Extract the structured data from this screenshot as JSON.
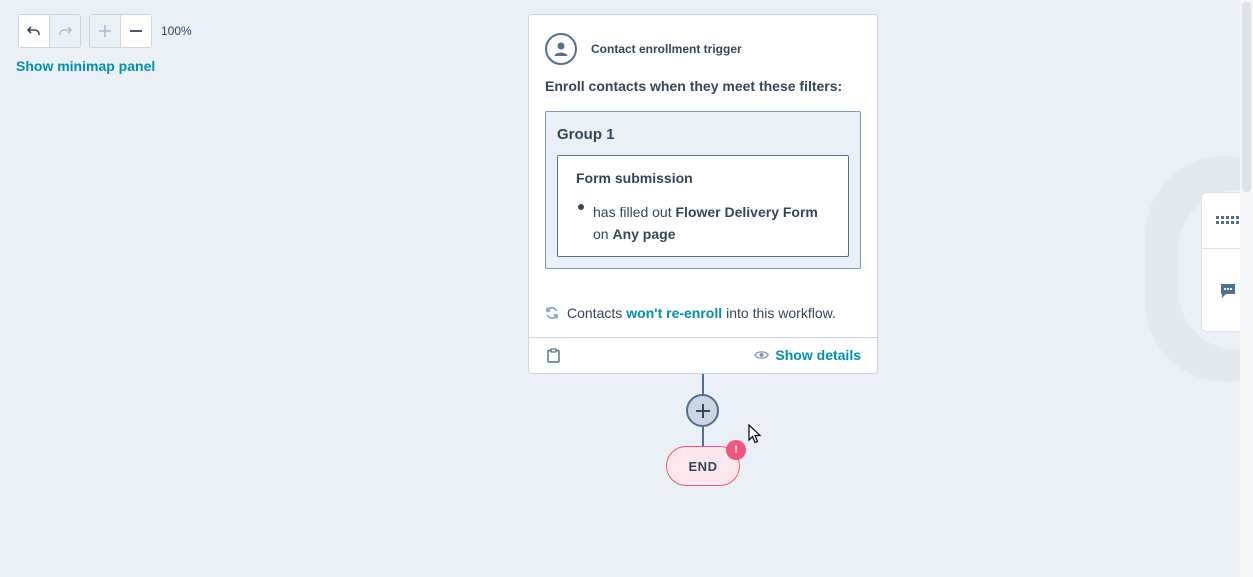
{
  "toolbar": {
    "zoom_level": "100%",
    "minimap_link": "Show minimap panel",
    "icons": [
      "undo-icon",
      "redo-icon",
      "zoom-in-icon",
      "zoom-out-icon"
    ]
  },
  "trigger_card": {
    "title": "Contact enrollment trigger",
    "enroll_text": "Enroll contacts when they meet these filters:",
    "group": {
      "title": "Group 1",
      "filter": {
        "title": "Form submission",
        "line1_prefix": "has filled out",
        "form_name": "Flower Delivery Form",
        "line2_prefix": "on",
        "page_value": "Any page"
      }
    },
    "reenroll": {
      "prefix": "Contacts",
      "link": "won't re-enroll",
      "suffix": "into this workflow."
    },
    "show_details": "Show details"
  },
  "flow": {
    "end_label": "END",
    "end_badge": "!"
  },
  "colors": {
    "canvas_bg": "#eaf0f6",
    "link": "#0091ae",
    "text": "#33475b",
    "end_badge": "#f2547d",
    "border": "#cbd6e2"
  }
}
